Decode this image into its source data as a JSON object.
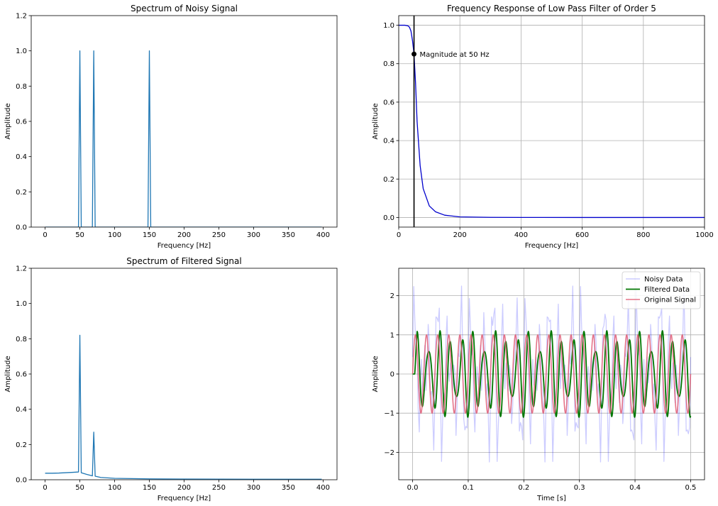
{
  "chart_data": [
    {
      "id": "noisy-spectrum",
      "type": "line",
      "title": "Spectrum of Noisy Signal",
      "xlabel": "Frequency [Hz]",
      "ylabel": "Amplitude",
      "xlim": [
        -20,
        420
      ],
      "ylim": [
        0,
        1.2
      ],
      "xticks": [
        0,
        50,
        100,
        150,
        200,
        250,
        300,
        350,
        400
      ],
      "yticks": [
        0.0,
        0.2,
        0.4,
        0.6,
        0.8,
        1.0,
        1.2
      ],
      "ytick_labels": [
        "0.0",
        "0.2",
        "0.4",
        "0.6",
        "0.8",
        "1.0",
        "1.2"
      ],
      "grid": false,
      "series": [
        {
          "color": "#1f77b4",
          "x": [
            0,
            48,
            50,
            52,
            68,
            70,
            72,
            148,
            150,
            152,
            398
          ],
          "y": [
            0,
            0,
            1.0,
            0,
            0,
            1.0,
            0,
            0,
            1.0,
            0,
            0
          ]
        }
      ]
    },
    {
      "id": "filter-response",
      "type": "line",
      "title": "Frequency Response of Low Pass Filter of Order 5",
      "xlabel": "Frequency [Hz]",
      "ylabel": "Amplitude",
      "xlim": [
        0,
        1000
      ],
      "ylim": [
        -0.05,
        1.05
      ],
      "xticks": [
        0,
        200,
        400,
        600,
        800,
        1000
      ],
      "yticks": [
        0.0,
        0.2,
        0.4,
        0.6,
        0.8,
        1.0
      ],
      "ytick_labels": [
        "0.0",
        "0.2",
        "0.4",
        "0.6",
        "0.8",
        "1.0"
      ],
      "grid": true,
      "series": [
        {
          "color": "#0000cc",
          "x": [
            0,
            20,
            30,
            35,
            40,
            45,
            50,
            55,
            60,
            70,
            80,
            100,
            120,
            150,
            200,
            300,
            400,
            600,
            800,
            1000
          ],
          "y": [
            1.0,
            1.0,
            0.997,
            0.99,
            0.97,
            0.92,
            0.85,
            0.7,
            0.5,
            0.27,
            0.15,
            0.06,
            0.03,
            0.012,
            0.003,
            0.0008,
            0.0003,
            0.0001,
            0.0,
            0.0
          ]
        }
      ],
      "vline": {
        "x": 50,
        "color": "#000000"
      },
      "point": {
        "x": 50,
        "y": 0.85
      },
      "annotation": "Magnitude at 50 Hz"
    },
    {
      "id": "filtered-spectrum",
      "type": "line",
      "title": "Spectrum of Filtered Signal",
      "xlabel": "Frequency [Hz]",
      "ylabel": "Amplitude",
      "xlim": [
        -20,
        420
      ],
      "ylim": [
        0,
        1.2
      ],
      "xticks": [
        0,
        50,
        100,
        150,
        200,
        250,
        300,
        350,
        400
      ],
      "yticks": [
        0.0,
        0.2,
        0.4,
        0.6,
        0.8,
        1.0,
        1.2
      ],
      "ytick_labels": [
        "0.0",
        "0.2",
        "0.4",
        "0.6",
        "0.8",
        "1.0",
        "1.2"
      ],
      "grid": false,
      "series": [
        {
          "color": "#1f77b4",
          "x": [
            0,
            10,
            20,
            30,
            40,
            48,
            50,
            52,
            60,
            68,
            70,
            72,
            80,
            100,
            150,
            200,
            300,
            398
          ],
          "y": [
            0.037,
            0.037,
            0.038,
            0.04,
            0.042,
            0.044,
            0.82,
            0.04,
            0.03,
            0.022,
            0.27,
            0.02,
            0.013,
            0.008,
            0.005,
            0.004,
            0.003,
            0.003
          ]
        }
      ]
    },
    {
      "id": "time-signals",
      "type": "line",
      "title": "",
      "xlabel": "Time [s]",
      "ylabel": "Amplitude",
      "xlim": [
        -0.025,
        0.525
      ],
      "ylim": [
        -2.7,
        2.7
      ],
      "xticks": [
        0.0,
        0.1,
        0.2,
        0.3,
        0.4,
        0.5
      ],
      "xtick_labels": [
        "0.0",
        "0.1",
        "0.2",
        "0.3",
        "0.4",
        "0.5"
      ],
      "yticks": [
        -2,
        -1,
        0,
        1,
        2
      ],
      "ytick_labels": [
        "−2",
        "−1",
        "0",
        "1",
        "2"
      ],
      "grid": true,
      "legend_position": "top-right",
      "series": [
        {
          "name": "Noisy Data",
          "color": "#0000ff",
          "opacity": 0.2,
          "gen": "noisy",
          "duration": 0.5,
          "samples": 250
        },
        {
          "name": "Filtered Data",
          "color": "#007700",
          "gen": "filtered",
          "duration": 0.5,
          "samples": 800
        },
        {
          "name": "Original Signal",
          "color": "#e05c74",
          "opacity": 0.85,
          "gen": "sine",
          "frequency_hz": 50,
          "duration": 0.5,
          "samples": 1000
        }
      ]
    }
  ]
}
